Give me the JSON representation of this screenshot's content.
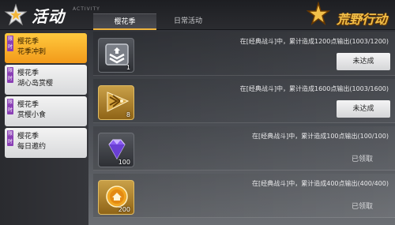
{
  "header": {
    "title": "活动",
    "title_sub": "ACTIVITY",
    "tabs": [
      {
        "label": "樱花季",
        "active": true
      },
      {
        "label": "日常活动",
        "active": false
      }
    ],
    "brand": "荒野行动"
  },
  "sidebar": {
    "items": [
      {
        "badge": "限时",
        "label": "樱花季",
        "sub": "花季冲刺",
        "active": true
      },
      {
        "badge": "限时",
        "label": "樱花季",
        "sub": "湖心岛赏樱",
        "active": false
      },
      {
        "badge": "限时",
        "label": "樱花季",
        "sub": "赏樱小食",
        "active": false
      },
      {
        "badge": "限时",
        "label": "樱花季",
        "sub": "每日邀约",
        "active": false
      }
    ]
  },
  "tasks": [
    {
      "text": "在[经典战斗]中，累计造成1200点输出(1003/1200)",
      "reward_icon": "silver-rank-chevron-icon",
      "reward_count": "1",
      "status": "未达成",
      "status_type": "button"
    },
    {
      "text": "在[经典战斗]中，累计造成1600点输出(1003/1600)",
      "reward_icon": "gold-rank-chevron-icon",
      "reward_count": "8",
      "status": "未达成",
      "status_type": "button"
    },
    {
      "text": "在[经典战斗]中，累计造成100点输出(100/100)",
      "reward_icon": "purple-diamond-icon",
      "reward_count": "100",
      "status": "已领取",
      "status_type": "text"
    },
    {
      "text": "在[经典战斗]中，累计造成400点输出(400/400)",
      "reward_icon": "gold-coin-icon",
      "reward_count": "200",
      "status": "已领取",
      "status_type": "text"
    }
  ]
}
